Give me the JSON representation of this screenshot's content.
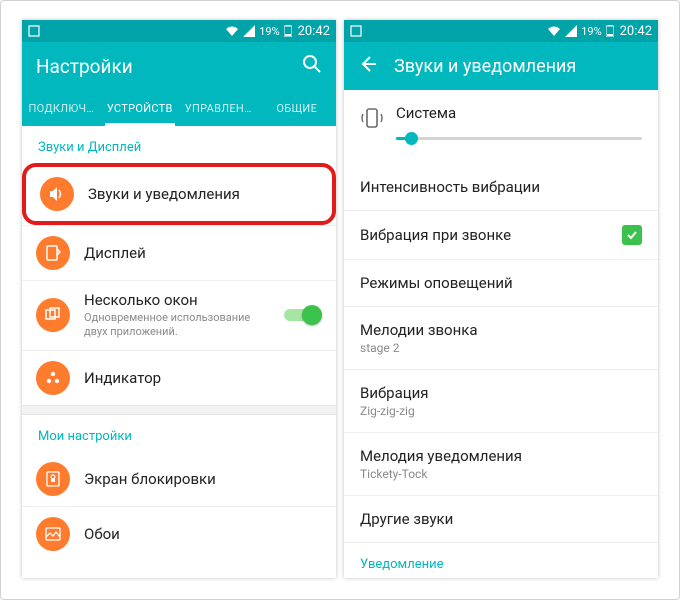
{
  "statusbar": {
    "battery": "19%",
    "time": "20:42"
  },
  "left": {
    "title": "Настройки",
    "tabs": [
      "ПОДКЛЮЧ…",
      "УСТРОЙСТВ",
      "УПРАВЛЕН…",
      "ОБЩИЕ"
    ],
    "section1": "Звуки и Дисплей",
    "items1": [
      {
        "title": "Звуки и уведомления"
      },
      {
        "title": "Дисплей"
      },
      {
        "title": "Несколько окон",
        "sub": "Одновременное использование двух приложений."
      },
      {
        "title": "Индикатор"
      }
    ],
    "section2": "Мои настройки",
    "items2": [
      {
        "title": "Экран блокировки"
      },
      {
        "title": "Обои"
      }
    ]
  },
  "right": {
    "title": "Звуки и уведомления",
    "system_label": "Система",
    "settings": [
      {
        "title": "Интенсивность вибрации"
      },
      {
        "title": "Вибрация при звонке",
        "checked": true
      },
      {
        "title": "Режимы оповещений"
      },
      {
        "title": "Мелодии звонка",
        "sub": "stage 2"
      },
      {
        "title": "Вибрация",
        "sub": "Zig-zig-zig"
      },
      {
        "title": "Мелодия уведомления",
        "sub": "Tickety-Tock"
      },
      {
        "title": "Другие звуки"
      }
    ],
    "section_notif": "Уведомление"
  }
}
